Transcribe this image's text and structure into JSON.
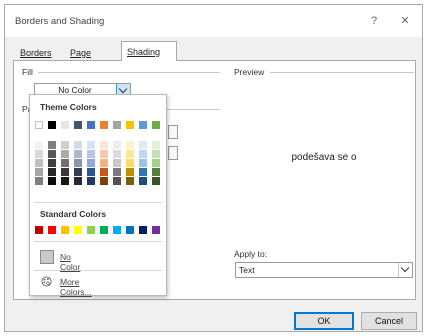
{
  "dialog": {
    "title": "Borders and Shading",
    "help_icon": "question-mark-icon",
    "close_icon": "close-icon",
    "tabs": [
      {
        "label": "Borders",
        "active": false
      },
      {
        "label": "Page Border",
        "active": false
      },
      {
        "label": "Shading",
        "active": true
      }
    ]
  },
  "shading": {
    "fill_label": "Fill",
    "fill_value": "No Color",
    "pattern_label_fragment": "Pa",
    "preview_label": "Preview",
    "preview_text": "podešava se o",
    "apply_label": "Apply to:",
    "apply_value": "Text"
  },
  "color_dropdown": {
    "theme_heading": "Theme Colors",
    "standard_heading": "Standard Colors",
    "no_color_label": "No Color",
    "more_colors_label": "More Colors...",
    "theme_top": [
      "#ffffff",
      "#000000",
      "#e7e6e6",
      "#44546a",
      "#4472c4",
      "#ed7d31",
      "#a5a5a5",
      "#ffc000",
      "#5b9bd5",
      "#70ad47"
    ],
    "theme_shades": [
      [
        "#f2f2f2",
        "#7f7f7f",
        "#d0cece",
        "#d6dce4",
        "#d9e2f3",
        "#fbe5d5",
        "#ededed",
        "#fff2cc",
        "#deebf6",
        "#e2efd9"
      ],
      [
        "#d8d8d8",
        "#595959",
        "#aeabab",
        "#adb9ca",
        "#b4c6e7",
        "#f7cbac",
        "#dbdbdb",
        "#fee599",
        "#bdd7ee",
        "#c5e0b3"
      ],
      [
        "#bfbfbf",
        "#3f3f3f",
        "#757070",
        "#8496b0",
        "#8eaadb",
        "#f4b183",
        "#c9c9c9",
        "#ffd965",
        "#9cc3e5",
        "#a8d08d"
      ],
      [
        "#a5a5a5",
        "#262626",
        "#3a3838",
        "#323f4f",
        "#2f5496",
        "#c55a11",
        "#7b7b7b",
        "#bf8f00",
        "#2e75b5",
        "#538135"
      ],
      [
        "#7f7f7f",
        "#0c0c0c",
        "#171616",
        "#222a35",
        "#1f3864",
        "#833c0b",
        "#525252",
        "#7f6000",
        "#1e4e79",
        "#375623"
      ]
    ],
    "standard": [
      "#c00000",
      "#ff0000",
      "#ffc000",
      "#ffff00",
      "#92d050",
      "#00b050",
      "#00b0f0",
      "#0070c0",
      "#002060",
      "#7030a0"
    ]
  },
  "buttons": {
    "ok": "OK",
    "cancel": "Cancel"
  }
}
